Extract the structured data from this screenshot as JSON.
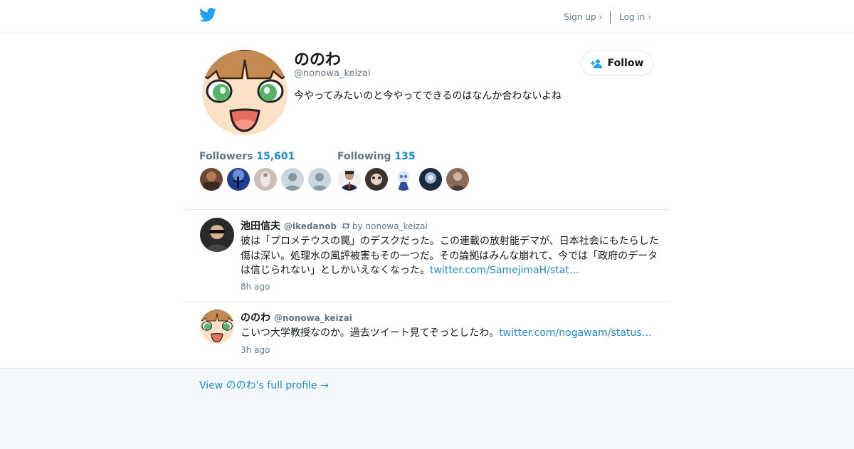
{
  "header": {
    "signup": "Sign up ›",
    "login": "Log in ›",
    "brand_color": "#1da1f2"
  },
  "profile": {
    "display_name": "ののわ",
    "handle": "@nonowa_keizai",
    "bio": "今やってみたいのと今やってできるのはなんか合わないよね",
    "follow_label": "Follow"
  },
  "stats": {
    "followers_label": "Followers",
    "followers_count": "15,601",
    "following_label": "Following",
    "following_count": "135"
  },
  "tweets": [
    {
      "name": "池田信夫",
      "username": "@ikedanob",
      "retweet_by": "by nonowa_keizai",
      "text": "彼は「プロメテウスの罠」のデスクだった。この連載の放射能デマが、日本社会にもたらした傷は深い。処理水の風評被害もその一つだ。その論拠はみんな崩れて、今では「政府のデータは信じられない」としかいえなくなった。",
      "link": "twitter.com/SamejimaH/stat…",
      "time": "8h ago"
    },
    {
      "name": "ののわ",
      "username": "@nonowa_keizai",
      "text": "こいつ大学教授なのか。過去ツイート見てぞっとしたわ。",
      "link": "twitter.com/nogawam/status…",
      "time": "3h ago"
    }
  ],
  "footer": {
    "full_profile": "View ののわ's full profile →"
  },
  "colors": {
    "link": "#1d8dd0",
    "muted": "#657786",
    "text": "#14171a",
    "border": "#e1e8ed",
    "footer_bg": "#f5f8fa"
  }
}
